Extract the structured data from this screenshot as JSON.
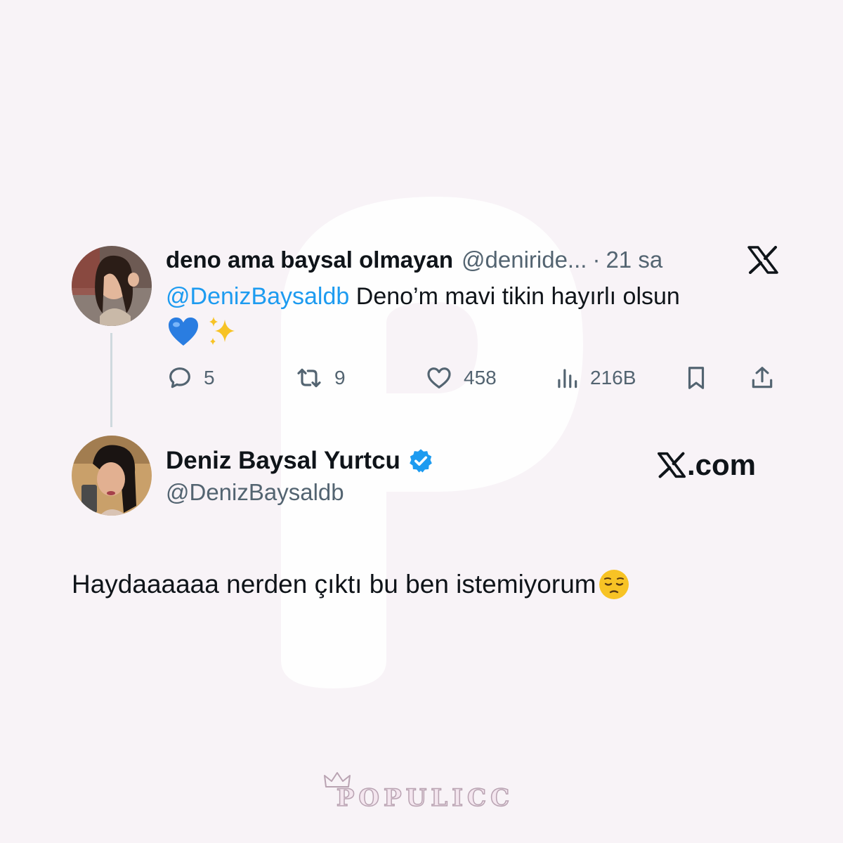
{
  "tweet": {
    "display_name": "deno ama baysal olmayan",
    "handle": "@deniride...",
    "separator": "·",
    "time": "21 sa",
    "mention": "@DenizBaysaldb",
    "text": " Deno’m mavi tikin hayırlı olsun",
    "emoji": [
      "blue-heart-emoji",
      "sparkles-emoji"
    ],
    "actions": {
      "replies": "5",
      "reposts": "9",
      "likes": "458",
      "views": "216B"
    }
  },
  "reply": {
    "display_name": "Deniz Baysal Yurtcu",
    "handle": "@DenizBaysaldb",
    "verified": true,
    "site_label": ".com",
    "text": "Haydaaaaaa nerden çıktı bu ben istemiyorum",
    "emoji": "pensive-face-emoji"
  },
  "branding": {
    "text": "POPULICC"
  },
  "colors": {
    "background": "#f8f3f7",
    "text": "#0f1419",
    "secondary_text": "#536471",
    "link": "#1d9bf0",
    "verified_badge": "#1d9bf0"
  }
}
